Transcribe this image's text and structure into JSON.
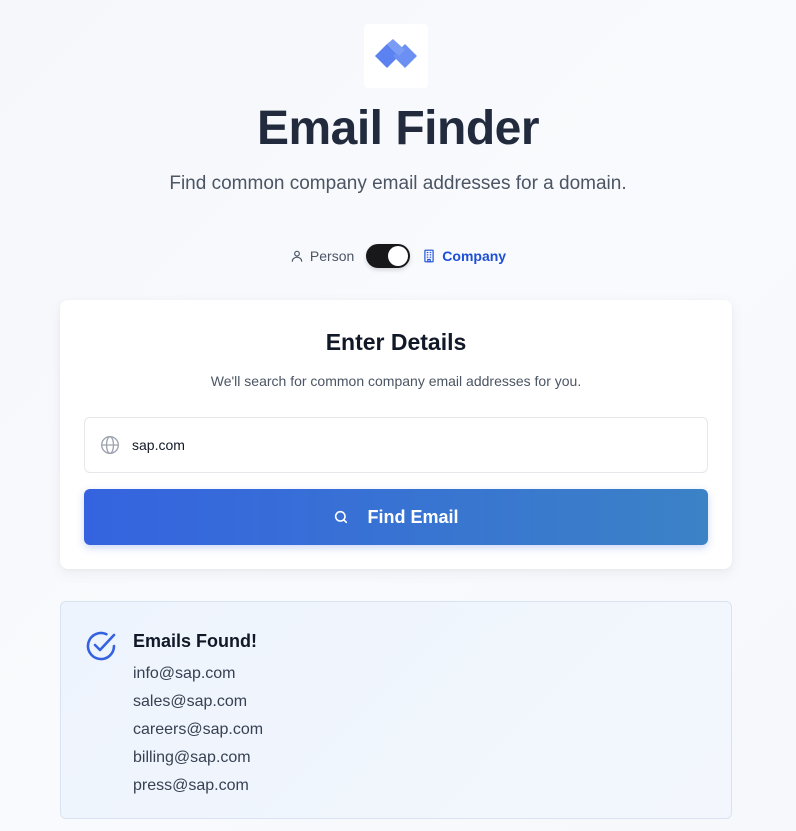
{
  "header": {
    "title": "Email Finder",
    "subtitle": "Find common company email addresses for a domain."
  },
  "mode": {
    "person_label": "Person",
    "company_label": "Company",
    "selected": "Company"
  },
  "form": {
    "title": "Enter Details",
    "description": "We'll search for common company email addresses for you.",
    "domain_value": "sap.com",
    "submit_label": "Find Email"
  },
  "results": {
    "title": "Emails Found!",
    "emails": [
      "info@sap.com",
      "sales@sap.com",
      "careers@sap.com",
      "billing@sap.com",
      "press@sap.com"
    ]
  },
  "icons": {
    "logo": "logo-icon",
    "person": "user-icon",
    "company": "building-icon",
    "domain": "globe-icon",
    "search": "search-icon",
    "success": "check-circle-icon"
  },
  "colors": {
    "accent": "#3563e0",
    "accent_end": "#3b82c6",
    "toggle": "#18181b",
    "company_active": "#1d4ed8",
    "logo": "#5b82f0"
  }
}
